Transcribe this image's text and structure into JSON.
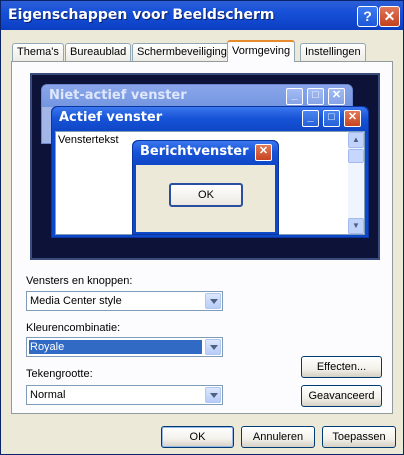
{
  "window": {
    "title": "Eigenschappen voor Beeldscherm"
  },
  "title_buttons": {
    "help": "?",
    "close": "✕"
  },
  "tabs": [
    {
      "label": "Thema's"
    },
    {
      "label": "Bureaublad"
    },
    {
      "label": "Schermbeveiliging"
    },
    {
      "label": "Vormgeving",
      "active": true
    },
    {
      "label": "Instellingen"
    }
  ],
  "preview": {
    "inactive_title": "Niet-actief venster",
    "active_title": "Actief venster",
    "window_text": "Venstertekst",
    "message_title": "Berichtvenster",
    "message_ok": "OK"
  },
  "form": {
    "windows_label": "Vensters en knoppen:",
    "windows_value": "Media Center style",
    "scheme_label": "Kleurencombinatie:",
    "scheme_value": "Royale",
    "fontsize_label": "Tekengrootte:",
    "fontsize_value": "Normal",
    "effects_button": "Effecten...",
    "advanced_button": "Geavanceerd"
  },
  "footer": {
    "ok": "OK",
    "cancel": "Annuleren",
    "apply": "Toepassen"
  },
  "colors": {
    "titlebar": "#1650d8",
    "selection": "#316ac5",
    "dialog_bg": "#ece9d8"
  }
}
